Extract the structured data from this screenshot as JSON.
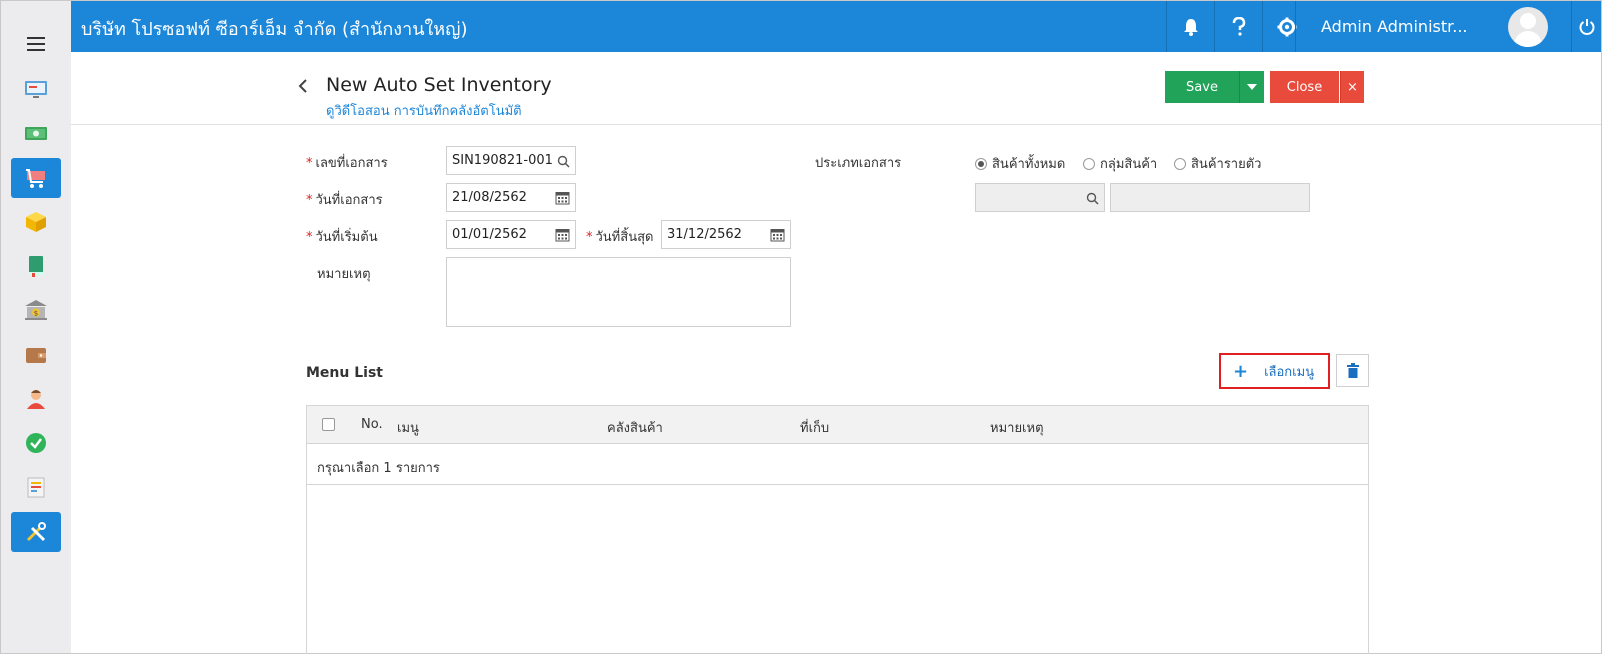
{
  "topbar": {
    "company": "บริษัท โปรซอฟท์ ซีอาร์เอ็ม จำกัด (สำนักงานใหญ่)",
    "user_name": "Admin Administr...",
    "brand_color": "#1c86d8"
  },
  "sidebar": {
    "items": [
      {
        "icon": "monitor-icon",
        "active": false
      },
      {
        "icon": "money-icon",
        "active": false
      },
      {
        "icon": "cart-icon",
        "active": true
      },
      {
        "icon": "box-icon",
        "active": false
      },
      {
        "icon": "book-icon",
        "active": false
      },
      {
        "icon": "bank-icon",
        "active": false
      },
      {
        "icon": "wallet-icon",
        "active": false
      },
      {
        "icon": "user-icon",
        "active": false
      },
      {
        "icon": "check-circle-icon",
        "active": false
      },
      {
        "icon": "document-icon",
        "active": false
      },
      {
        "icon": "tools-icon",
        "active": true
      }
    ]
  },
  "header": {
    "title": "New Auto Set Inventory",
    "subtitle": "ดูวิดีโอสอน การบันทึกคลังอัตโนมัติ",
    "save_label": "Save",
    "close_label": "Close",
    "close_x": "×"
  },
  "form": {
    "doc_no_label": "เลขที่เอกสาร",
    "doc_no_value": "SIN190821-001",
    "doc_date_label": "วันที่เอกสาร",
    "doc_date_value": "21/08/2562",
    "start_date_label": "วันที่เริ่มต้น",
    "start_date_value": "01/01/2562",
    "end_date_label": "วันที่สิ้นสุด",
    "end_date_value": "31/12/2562",
    "remark_label": "หมายเหตุ",
    "doc_type_label": "ประเภทเอกสาร",
    "doc_type_options": [
      "สินค้าทั้งหมด",
      "กลุ่มสินค้า",
      "สินค้ารายตัว"
    ],
    "doc_type_selected": "สินค้าทั้งหมด",
    "required_mark": "*"
  },
  "menu_list": {
    "title": "Menu List",
    "select_button": "เลือกเมนู",
    "plus": "+",
    "columns": [
      "No.",
      "เมนู",
      "คลังสินค้า",
      "ที่เก็บ",
      "หมายเหตุ"
    ],
    "empty_text": "กรุณาเลือก 1 รายการ"
  }
}
